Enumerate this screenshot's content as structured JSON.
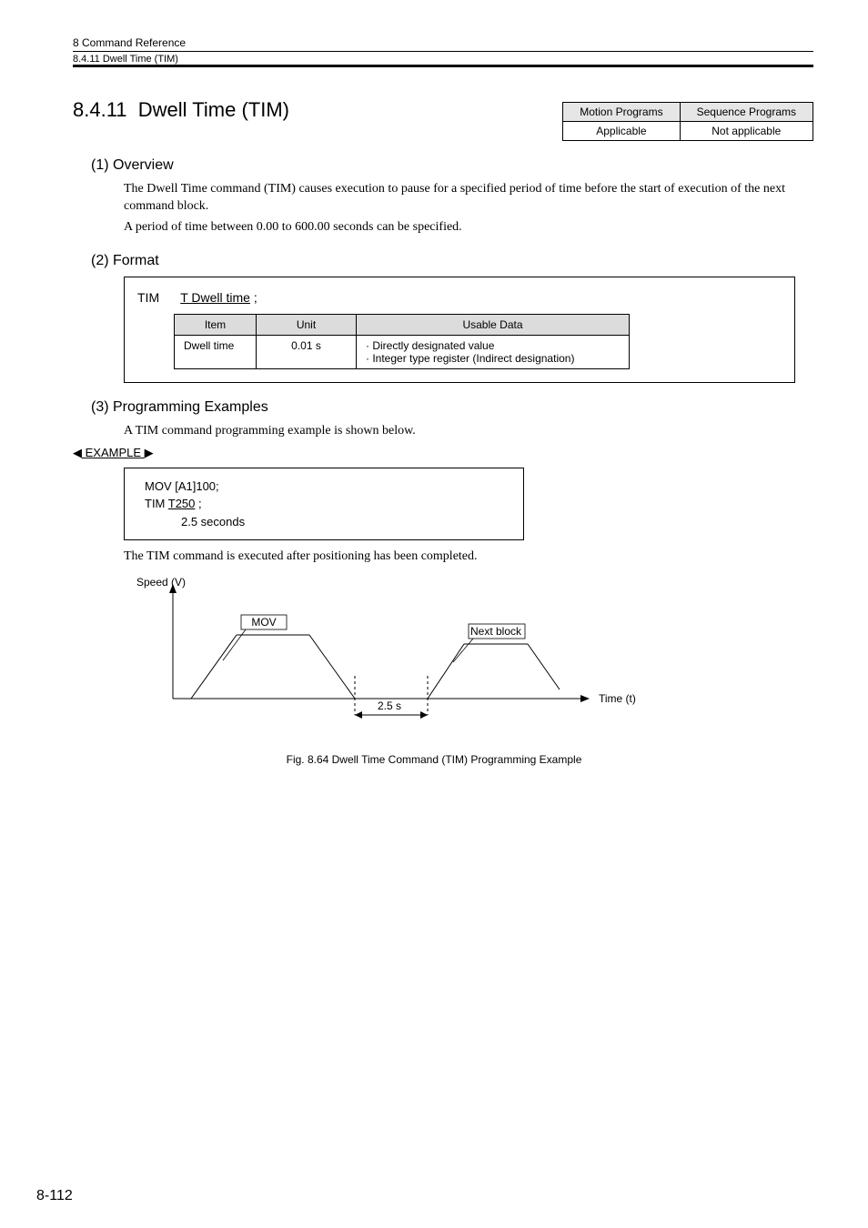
{
  "header": {
    "chapter": "8  Command Reference",
    "subsection": "8.4.11  Dwell Time (TIM)"
  },
  "section": {
    "number": "8.4.11",
    "title": "Dwell Time (TIM)"
  },
  "applicability": {
    "col1_head": "Motion Programs",
    "col2_head": "Sequence Programs",
    "col1_val": "Applicable",
    "col2_val": "Not applicable"
  },
  "overview": {
    "heading": "(1) Overview",
    "p1": "The Dwell Time command (TIM) causes execution to pause for a specified period of time before the start of execution of the next command block.",
    "p2": "A period of time between 0.00 to 600.00 seconds can be specified."
  },
  "format": {
    "heading": "(2) Format",
    "cmd_label": "TIM",
    "cmd_arg": "T Dwell time",
    "semicolon": ";",
    "table": {
      "h_item": "Item",
      "h_unit": "Unit",
      "h_data": "Usable Data",
      "r_item": "Dwell time",
      "r_unit": "0.01 s",
      "r_data1": "· Directly designated value",
      "r_data2": "· Integer type register (Indirect designation)"
    }
  },
  "examples": {
    "heading": "(3) Programming Examples",
    "lead": "A TIM command programming example is shown below.",
    "label": "EXAMPLE",
    "code_l1a": "MOV [A1]100;",
    "code_l2a": "TIM ",
    "code_l2b": "T250",
    "code_l2c": " ;",
    "code_l3": "2.5 seconds",
    "after": "The TIM command is executed after positioning has been completed."
  },
  "diagram": {
    "ylabel": "Speed (V)",
    "mov": "MOV",
    "next": "Next block",
    "time": "Time (t)",
    "dwell": "2.5 s"
  },
  "figcaption": "Fig. 8.64  Dwell Time Command (TIM) Programming Example",
  "page": "8-112"
}
